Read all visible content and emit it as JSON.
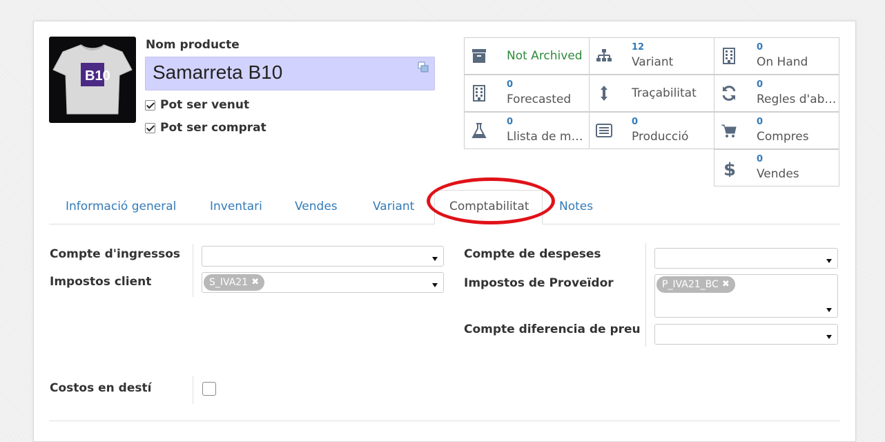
{
  "product": {
    "name_label": "Nom producte",
    "name": "Samarreta B10",
    "can_be_sold": "Pot ser venut",
    "can_be_purchased": "Pot ser comprat",
    "image_logo_text": "B10"
  },
  "smart_buttons": [
    {
      "id": "archived",
      "label": "Not Archived",
      "icon": "archive-icon"
    },
    {
      "id": "variant",
      "count": "12",
      "label": "Variant",
      "icon": "sitemap-icon"
    },
    {
      "id": "on-hand",
      "count": "0",
      "label": "On Hand",
      "icon": "building-icon"
    },
    {
      "id": "forecasted",
      "count": "0",
      "label": "Forecasted",
      "icon": "building-icon"
    },
    {
      "id": "traceability",
      "label": "Traçabilitat",
      "icon": "arrows-v-icon"
    },
    {
      "id": "reorder-rules",
      "count": "0",
      "label": "Regles d'aba...",
      "icon": "refresh-icon"
    },
    {
      "id": "bom",
      "count": "0",
      "label": "Llista de mat...",
      "icon": "flask-icon"
    },
    {
      "id": "production",
      "count": "0",
      "label": "Producció",
      "icon": "list-alt-icon"
    },
    {
      "id": "purchases",
      "count": "0",
      "label": "Compres",
      "icon": "shopping-cart-icon"
    },
    {
      "id": "sales",
      "count": "0",
      "label": "Vendes",
      "icon": "dollar-icon"
    }
  ],
  "tabs": [
    {
      "label": "Informació general"
    },
    {
      "label": "Inventari"
    },
    {
      "label": "Vendes"
    },
    {
      "label": "Variant"
    },
    {
      "label": "Comptabilitat",
      "active": true
    },
    {
      "label": "Notes"
    }
  ],
  "accounting": {
    "income_account_label": "Compte d'ingressos",
    "income_account_value": "",
    "customer_taxes_label": "Impostos client",
    "customer_taxes_tag": "S_IVA21",
    "expense_account_label": "Compte de despeses",
    "expense_account_value": "",
    "vendor_taxes_label": "Impostos de Proveïdor",
    "vendor_taxes_tag": "P_IVA21_BC",
    "price_diff_label": "Compte diferencia de preu",
    "price_diff_value": "",
    "landed_costs_label": "Costos en destí",
    "landed_costs_checked": false
  },
  "colors": {
    "link": "#337ab7",
    "name_field_bg": "#d2d2ff",
    "annotation_ring": "#e01218",
    "archived_green": "#2e8b3a"
  }
}
